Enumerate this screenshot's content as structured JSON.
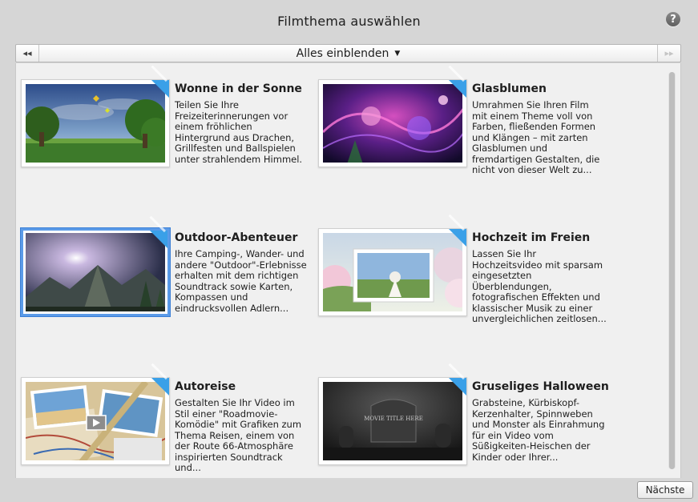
{
  "window": {
    "title": "Filmthema auswählen",
    "help_label": "?"
  },
  "nav": {
    "prev_label": "◂◂",
    "next_label": "▸▸",
    "filter_label": "Alles einblenden",
    "filter_caret": "▼"
  },
  "themes": [
    {
      "name": "Wonne in der Sonne",
      "description": "Teilen Sie Ihre Freizeiterinnerungen vor einem fröhlichen Hintergrund aus Drachen, Grillfesten und Ballspielen unter strahlendem Himmel."
    },
    {
      "name": "Glasblumen",
      "description": "Umrahmen Sie Ihren Film mit einem Theme voll von Farben, fließenden Formen und Klängen – mit zarten Glasblumen und fremdartigen Gestalten, die nicht von dieser Welt zu..."
    },
    {
      "name": "Outdoor-Abenteuer",
      "description": "Ihre Camping-, Wander- und andere \"Outdoor\"-Erlebnisse erhalten mit dem richtigen Soundtrack sowie Karten, Kompassen und eindrucksvollen Adlern..."
    },
    {
      "name": "Hochzeit im Freien",
      "description": "Lassen Sie Ihr Hochzeitsvideo mit sparsam eingesetzten Überblendungen, fotografischen Effekten und klassischer Musik zu einer unvergleichlichen zeitlosen..."
    },
    {
      "name": "Autoreise",
      "description": "Gestalten Sie Ihr Video im Stil einer \"Roadmovie-Komödie\" mit Grafiken zum Thema Reisen, einem von der Route 66-Atmosphäre inspirierten Soundtrack und..."
    },
    {
      "name": "Gruseliges Halloween",
      "description": "Grabsteine, Kürbiskopf-Kerzenhalter, Spinnweben und Monster als Einrahmung für ein Video vom Süßigkeiten-Heischen der Kinder oder Ihrer..."
    }
  ],
  "thumb_texts": {
    "halloween_title": "MOVIE TITLE HERE"
  },
  "footer": {
    "next_label": "Nächste"
  },
  "colors": {
    "selection": "#5b9be8",
    "corner_badge": "#3aa0e8",
    "background": "#d6d6d6"
  }
}
